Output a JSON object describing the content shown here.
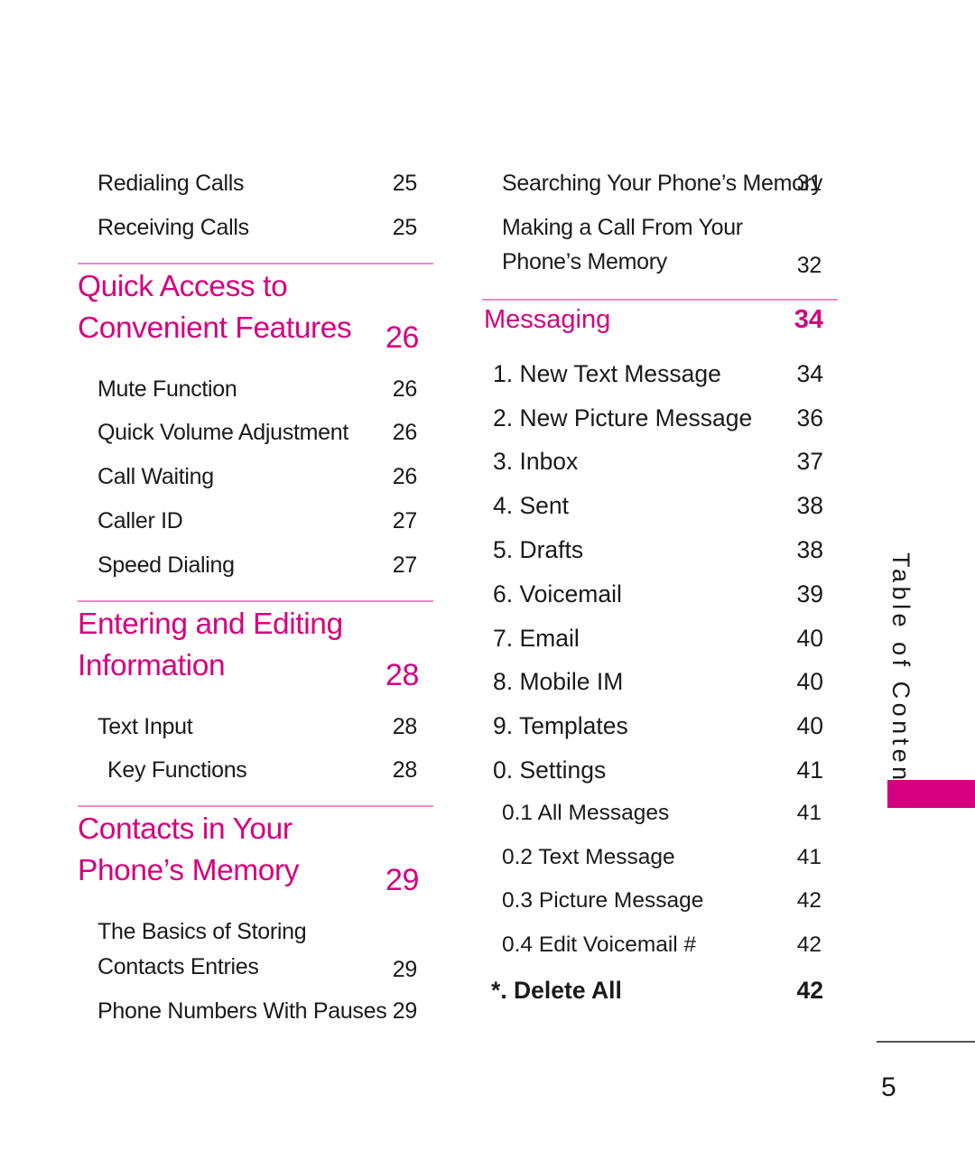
{
  "left_column": {
    "intro_items": [
      {
        "label": "Redialing Calls",
        "page": "25"
      },
      {
        "label": "Receiving Calls",
        "page": "25"
      }
    ],
    "sections": [
      {
        "title": "Quick Access to Convenient Features",
        "page": "26",
        "items": [
          {
            "label": "Mute Function",
            "page": "26"
          },
          {
            "label": "Quick Volume Adjustment",
            "page": "26"
          },
          {
            "label": "Call Waiting",
            "page": "26"
          },
          {
            "label": "Caller ID",
            "page": "27"
          },
          {
            "label": "Speed Dialing",
            "page": "27"
          }
        ]
      },
      {
        "title": "Entering and Editing Information",
        "page": "28",
        "items": [
          {
            "label": "Text Input",
            "page": "28"
          },
          {
            "label": "Key Functions",
            "page": "28"
          }
        ]
      },
      {
        "title": "Contacts in Your Phone’s Memory",
        "page": "29",
        "items": [
          {
            "label": "The Basics of Storing Contacts Entries",
            "page": "29"
          },
          {
            "label": "Phone Numbers With Pauses",
            "page": "29"
          }
        ]
      }
    ]
  },
  "right_column": {
    "intro_items": [
      {
        "label": "Searching Your Phone’s Memory",
        "page": "31"
      },
      {
        "label": "Making a Call From Your Phone’s Memory",
        "page": "32"
      }
    ],
    "section": {
      "title": "Messaging",
      "page": "34",
      "items": [
        {
          "label": "1. New Text Message",
          "page": "34"
        },
        {
          "label": "2. New Picture Message",
          "page": "36"
        },
        {
          "label": "3. Inbox",
          "page": "37"
        },
        {
          "label": "4. Sent",
          "page": "38"
        },
        {
          "label": "5. Drafts",
          "page": "38"
        },
        {
          "label": "6. Voicemail",
          "page": "39"
        },
        {
          "label": "7. Email",
          "page": "40"
        },
        {
          "label": "8. Mobile IM",
          "page": "40"
        },
        {
          "label": "9. Templates",
          "page": "40"
        },
        {
          "label": "0. Settings",
          "page": "41"
        },
        {
          "label": "0.1  All Messages",
          "page": "41"
        },
        {
          "label": "0.2 Text Message",
          "page": "41"
        },
        {
          "label": "0.3 Picture Message",
          "page": "42"
        },
        {
          "label": "0.4 Edit Voicemail #",
          "page": "42"
        },
        {
          "label": "*. Delete All",
          "page": "42"
        }
      ]
    }
  },
  "side_tab": {
    "label": "Table of Contents",
    "color": "#d6007e"
  },
  "page_number": "5",
  "colors": {
    "accent": "#d6007e",
    "divider": "#ee8ac3",
    "text": "#1a1a1a"
  }
}
